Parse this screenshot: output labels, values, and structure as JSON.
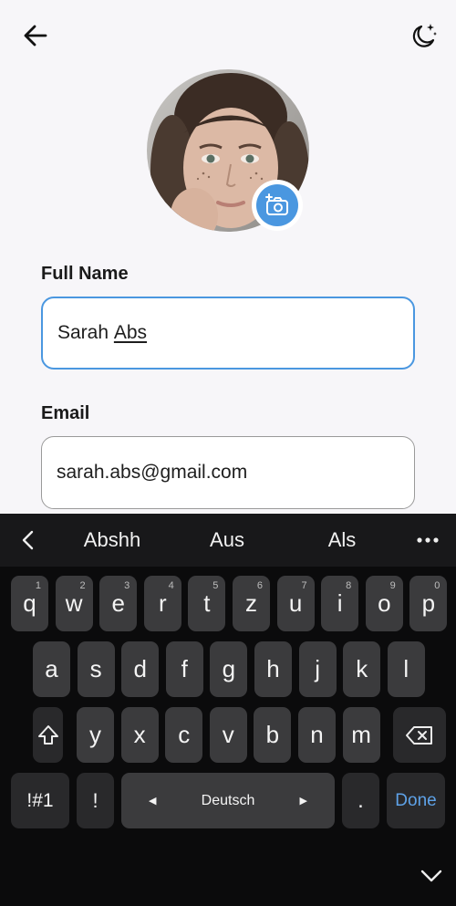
{
  "header": {
    "back_icon": "arrow-left-icon",
    "theme_icon": "moon-stars-icon"
  },
  "profile": {
    "avatar_icon": "profile-photo",
    "camera_icon": "add-photo-camera-icon",
    "accent": "#4a97e0"
  },
  "form": {
    "full_name_label": "Full Name",
    "full_name_first": "Sarah ",
    "full_name_composing": "Abs",
    "email_label": "Email",
    "email_value": "sarah.abs@gmail.com"
  },
  "keyboard": {
    "suggestions": [
      "Abshh",
      "Aus",
      "Als"
    ],
    "row1": [
      {
        "k": "q",
        "h": "1"
      },
      {
        "k": "w",
        "h": "2"
      },
      {
        "k": "e",
        "h": "3"
      },
      {
        "k": "r",
        "h": "4"
      },
      {
        "k": "t",
        "h": "5"
      },
      {
        "k": "z",
        "h": "6"
      },
      {
        "k": "u",
        "h": "7"
      },
      {
        "k": "i",
        "h": "8"
      },
      {
        "k": "o",
        "h": "9"
      },
      {
        "k": "p",
        "h": "0"
      }
    ],
    "row2": [
      "a",
      "s",
      "d",
      "f",
      "g",
      "h",
      "j",
      "k",
      "l"
    ],
    "row3": [
      "y",
      "x",
      "c",
      "v",
      "b",
      "n",
      "m"
    ],
    "symbols_label": "!#1",
    "exclaim_label": "!",
    "space_label": "Deutsch",
    "period_label": ".",
    "done_label": "Done",
    "done_color": "#5ea2e8"
  }
}
